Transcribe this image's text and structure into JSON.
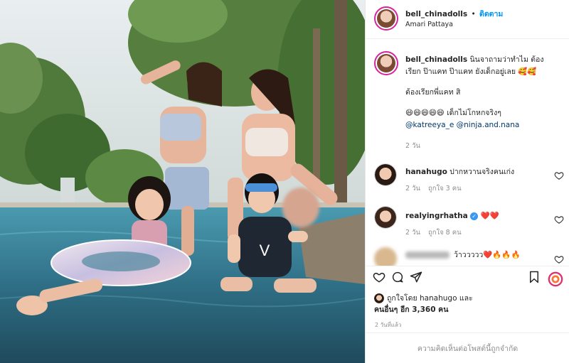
{
  "post": {
    "username": "bell_chinadolls",
    "follow_label": "ติดตาม",
    "dot": "•",
    "location": "Amari Pattaya"
  },
  "caption": {
    "username": "bell_chinadolls",
    "line1": "นินจาถามว่าทำไม ต้อง",
    "line2": "เรียก ป๊าแคท ป๊าแคท ยังเด็กอยู่เลย 🥰🥰",
    "line3": "ต้องเรียกพี่แคท สิ",
    "line4": "😄😄😄😄😄 เด็กไม่โกหกจริงๆ",
    "mentions": "@katreeya_e @ninja.and.nana",
    "time": "2 วัน"
  },
  "comments": [
    {
      "username": "hanahugo",
      "text": "ปากหวานจริงคนเก่ง",
      "time": "2 วัน",
      "likes": "ถูกใจ 3 คน"
    },
    {
      "username": "realyingrhatha",
      "text": "❤️❤️",
      "time": "2 วัน",
      "likes": "ถูกใจ 8 คน"
    },
    {
      "username": "",
      "text": "ว้าววววว❤️🔥🔥🔥",
      "time": "",
      "likes": ""
    }
  ],
  "likes_line1": "ถูกใจโดย hanahugo และ",
  "likes_line2": "คนอื่นๆ อีก 3,360 คน",
  "date": "2 วันที่แล้ว",
  "comments_disabled": "ความคิดเห็นต่อโพสต์นี้ถูกจำกัด",
  "colors": {
    "link": "#0095f6",
    "mention": "#00376b",
    "heart": "#ed4956",
    "verified": "#3897f0"
  },
  "icons": [
    "heart-icon",
    "comment-icon",
    "share-icon",
    "bookmark-icon",
    "more-icon"
  ]
}
